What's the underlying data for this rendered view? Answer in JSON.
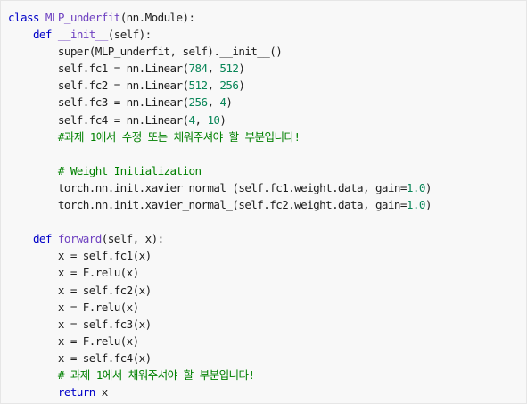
{
  "colors": {
    "background": "#f8f8f8",
    "keyword": "#0000c8",
    "class_name": "#6f42c1",
    "number": "#098658",
    "comment": "#008000",
    "text": "#1f1f1f"
  },
  "code": {
    "lines": [
      [
        {
          "t": "class",
          "c": "kw"
        },
        {
          "t": " ",
          "c": "plain"
        },
        {
          "t": "MLP_underfit",
          "c": "cls"
        },
        {
          "t": "(nn.Module):",
          "c": "plain"
        }
      ],
      [
        {
          "t": "    ",
          "c": "plain"
        },
        {
          "t": "def",
          "c": "kw"
        },
        {
          "t": " ",
          "c": "plain"
        },
        {
          "t": "__init__",
          "c": "fn"
        },
        {
          "t": "(self):",
          "c": "plain"
        }
      ],
      [
        {
          "t": "        super(MLP_underfit, self).__init__()",
          "c": "plain"
        }
      ],
      [
        {
          "t": "        self.fc1 = nn.Linear(",
          "c": "plain"
        },
        {
          "t": "784",
          "c": "num"
        },
        {
          "t": ", ",
          "c": "plain"
        },
        {
          "t": "512",
          "c": "num"
        },
        {
          "t": ")",
          "c": "plain"
        }
      ],
      [
        {
          "t": "        self.fc2 = nn.Linear(",
          "c": "plain"
        },
        {
          "t": "512",
          "c": "num"
        },
        {
          "t": ", ",
          "c": "plain"
        },
        {
          "t": "256",
          "c": "num"
        },
        {
          "t": ")",
          "c": "plain"
        }
      ],
      [
        {
          "t": "        self.fc3 = nn.Linear(",
          "c": "plain"
        },
        {
          "t": "256",
          "c": "num"
        },
        {
          "t": ", ",
          "c": "plain"
        },
        {
          "t": "4",
          "c": "num"
        },
        {
          "t": ")",
          "c": "plain"
        }
      ],
      [
        {
          "t": "        self.fc4 = nn.Linear(",
          "c": "plain"
        },
        {
          "t": "4",
          "c": "num"
        },
        {
          "t": ", ",
          "c": "plain"
        },
        {
          "t": "10",
          "c": "num"
        },
        {
          "t": ")",
          "c": "plain"
        }
      ],
      [
        {
          "t": "        ",
          "c": "plain"
        },
        {
          "t": "#과제 1에서 수정 또는 채워주셔야 할 부분입니다!",
          "c": "cmt"
        }
      ],
      [
        {
          "t": "",
          "c": "plain"
        }
      ],
      [
        {
          "t": "        ",
          "c": "plain"
        },
        {
          "t": "# Weight Initialization",
          "c": "cmt"
        }
      ],
      [
        {
          "t": "        torch.nn.init.xavier_normal_(self.fc1.weight.data, gain=",
          "c": "plain"
        },
        {
          "t": "1.0",
          "c": "num"
        },
        {
          "t": ")",
          "c": "plain"
        }
      ],
      [
        {
          "t": "        torch.nn.init.xavier_normal_(self.fc2.weight.data, gain=",
          "c": "plain"
        },
        {
          "t": "1.0",
          "c": "num"
        },
        {
          "t": ")",
          "c": "plain"
        }
      ],
      [
        {
          "t": "",
          "c": "plain"
        }
      ],
      [
        {
          "t": "    ",
          "c": "plain"
        },
        {
          "t": "def",
          "c": "kw"
        },
        {
          "t": " ",
          "c": "plain"
        },
        {
          "t": "forward",
          "c": "fn"
        },
        {
          "t": "(self, x):",
          "c": "plain"
        }
      ],
      [
        {
          "t": "        x = self.fc1(x)",
          "c": "plain"
        }
      ],
      [
        {
          "t": "        x = F.relu(x)",
          "c": "plain"
        }
      ],
      [
        {
          "t": "        x = self.fc2(x)",
          "c": "plain"
        }
      ],
      [
        {
          "t": "        x = F.relu(x)",
          "c": "plain"
        }
      ],
      [
        {
          "t": "        x = self.fc3(x)",
          "c": "plain"
        }
      ],
      [
        {
          "t": "        x = F.relu(x)",
          "c": "plain"
        }
      ],
      [
        {
          "t": "        x = self.fc4(x)",
          "c": "plain"
        }
      ],
      [
        {
          "t": "        ",
          "c": "plain"
        },
        {
          "t": "# 과제 1에서 채워주셔야 할 부분입니다!",
          "c": "cmt"
        }
      ],
      [
        {
          "t": "        ",
          "c": "plain"
        },
        {
          "t": "return",
          "c": "kw"
        },
        {
          "t": " x",
          "c": "plain"
        }
      ]
    ]
  }
}
